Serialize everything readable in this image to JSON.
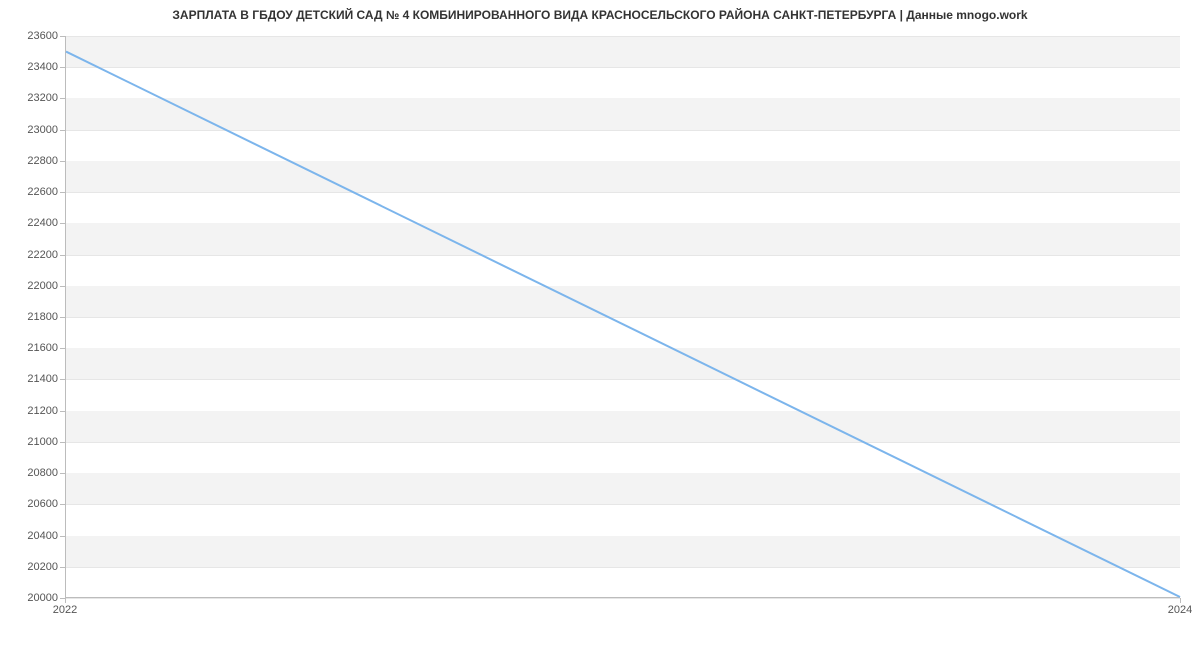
{
  "chart_data": {
    "type": "line",
    "title": "ЗАРПЛАТА В ГБДОУ ДЕТСКИЙ САД № 4 КОМБИНИРОВАННОГО ВИДА КРАСНОСЕЛЬСКОГО РАЙОНА САНКТ-ПЕТЕРБУРГА | Данные mnogo.work",
    "xlabel": "",
    "ylabel": "",
    "x": [
      2022,
      2024
    ],
    "values": [
      23500,
      20000
    ],
    "xlim": [
      2022,
      2024
    ],
    "ylim": [
      20000,
      23600
    ],
    "y_ticks": [
      20000,
      20200,
      20400,
      20600,
      20800,
      21000,
      21200,
      21400,
      21600,
      21800,
      22000,
      22200,
      22400,
      22600,
      22800,
      23000,
      23200,
      23400,
      23600
    ],
    "x_ticks": [
      2022,
      2024
    ],
    "line_color": "#7cb5ec",
    "band_color": "#f3f3f3"
  }
}
